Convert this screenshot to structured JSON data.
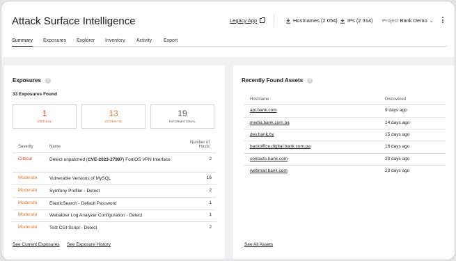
{
  "header": {
    "title": "Attack Surface Intelligence",
    "legacy_app": "Legacy App",
    "hostnames": "Hostnames (2 054)",
    "ips": "IPs (2 314)",
    "project_label": "Project",
    "project_value": "Bank Demo"
  },
  "tabs": [
    "Summary",
    "Exposures",
    "Explorer",
    "Inventory",
    "Activity",
    "Export"
  ],
  "exposures": {
    "title": "Exposures",
    "found": "33 Exposures Found",
    "cards": [
      {
        "num": "1",
        "label": "CRITICAL"
      },
      {
        "num": "13",
        "label": "MODERATE"
      },
      {
        "num": "19",
        "label": "INFORMATIONAL"
      }
    ],
    "columns": {
      "severity": "Severity",
      "name": "Name",
      "hosts_line1": "Number of",
      "hosts_line2": "Hosts"
    },
    "rows": [
      {
        "severity": "Critical",
        "name_pre": "Detect unpatched (",
        "name_bold": "CVE-2023-27997",
        "name_post": ") FortiOS VPN Interface",
        "hosts": "2"
      },
      {
        "severity": "Moderate",
        "name": "Vulnerable Versions of MySQL",
        "hosts": "16"
      },
      {
        "severity": "Moderate",
        "name": "Symfony Profiler - Detect",
        "hosts": "2"
      },
      {
        "severity": "Moderate",
        "name": "ElasticSearch - Default Password",
        "hosts": "1"
      },
      {
        "severity": "Moderate",
        "name": "Webalizer Log Analyzer Configuration - Detect",
        "hosts": "1"
      },
      {
        "severity": "Moderate",
        "name": "Test CGI Script - Detect",
        "hosts": "2"
      }
    ],
    "links": {
      "current": "See Current Exposures",
      "history": "See Exposure History"
    }
  },
  "assets": {
    "title": "Recently Found Assets",
    "columns": {
      "hostname": "Hostname",
      "discovered": "Discovered"
    },
    "rows": [
      {
        "host": "api.bank.com",
        "discovered": "9 days ago"
      },
      {
        "host": "media.bank.com.pa",
        "discovered": "14 days ago"
      },
      {
        "host": "dev.bank.by",
        "discovered": "15 days ago"
      },
      {
        "host": "backoffice.digital.bank.com.pa",
        "discovered": "16 days ago"
      },
      {
        "host": "contacts.bank.com",
        "discovered": "23 days ago"
      },
      {
        "host": "webmail.bank.com",
        "discovered": "23 days ago"
      }
    ],
    "link_all": "See All Assets"
  },
  "colors": {
    "critical": "#d9401c",
    "moderate": "#e07a2e",
    "informational": "#555555"
  },
  "icons": [
    "external-link-icon",
    "download-icon",
    "chevron-down-icon",
    "more-vertical-icon",
    "help-icon"
  ]
}
